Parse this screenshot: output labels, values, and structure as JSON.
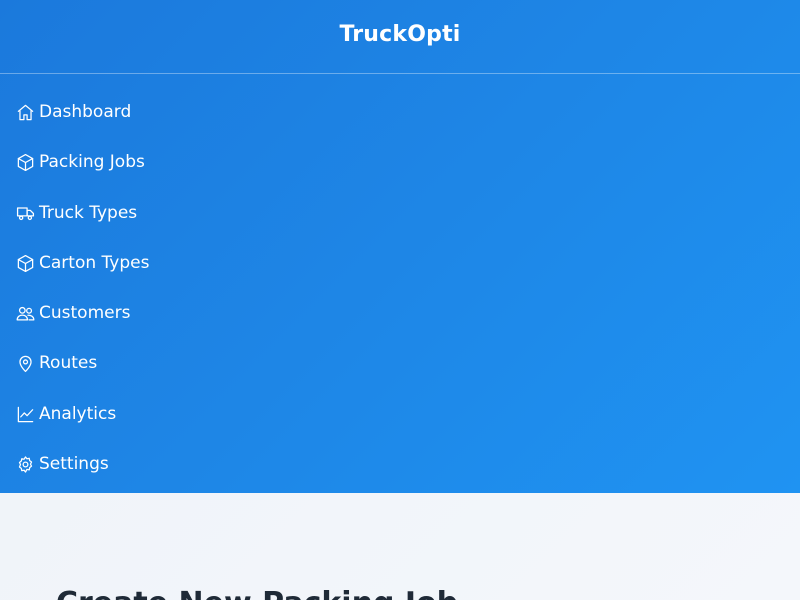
{
  "sidebar": {
    "brand": "TruckOpti",
    "items": [
      {
        "label": "Dashboard",
        "icon": "home-icon"
      },
      {
        "label": "Packing Jobs",
        "icon": "box-icon"
      },
      {
        "label": "Truck Types",
        "icon": "truck-icon"
      },
      {
        "label": "Carton Types",
        "icon": "box-icon"
      },
      {
        "label": "Customers",
        "icon": "users-icon"
      },
      {
        "label": "Routes",
        "icon": "map-pin-icon"
      },
      {
        "label": "Analytics",
        "icon": "chart-line-icon"
      },
      {
        "label": "Settings",
        "icon": "gear-icon"
      }
    ]
  },
  "main": {
    "title": "Create New Packing Job"
  },
  "colors": {
    "sidebar_start": "#1b79dc",
    "sidebar_end": "#1f93f2",
    "background": "#eef2f8",
    "title_text": "#1f2a37"
  }
}
